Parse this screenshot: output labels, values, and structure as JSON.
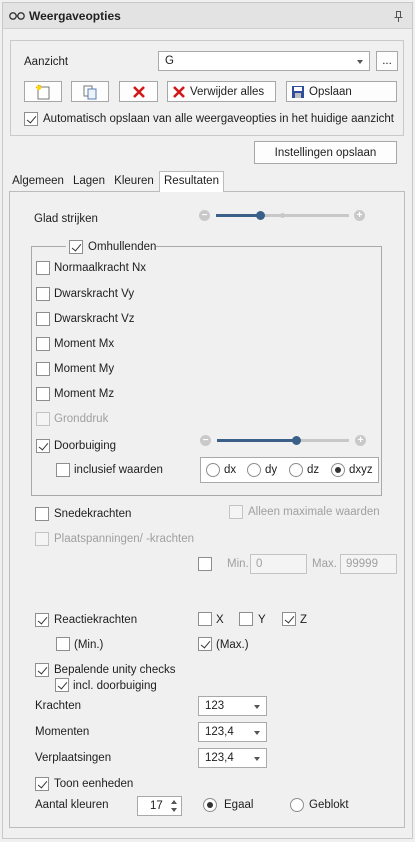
{
  "title": "Weergaveopties",
  "view": {
    "label": "Aanzicht",
    "value": "G",
    "more_label": "...",
    "delete_all_label": "Verwijder alles",
    "save_label": "Opslaan",
    "autosave_label": "Automatisch opslaan van alle weergaveopties in het huidige aanzicht",
    "save_settings_label": "Instellingen opslaan"
  },
  "tabs": [
    {
      "label": "Algemeen"
    },
    {
      "label": "Lagen"
    },
    {
      "label": "Kleuren"
    },
    {
      "label": "Resultaten"
    }
  ],
  "results": {
    "smooth_label": "Glad strijken",
    "smooth_level": 0.33,
    "envelopes_label": "Omhullenden",
    "options": [
      {
        "label": "Normaalkracht Nx",
        "checked": false,
        "disabled": false
      },
      {
        "label": "Dwarskracht Vy",
        "checked": false,
        "disabled": false
      },
      {
        "label": "Dwarskracht Vz",
        "checked": false,
        "disabled": false
      },
      {
        "label": "Moment Mx",
        "checked": false,
        "disabled": false
      },
      {
        "label": "Moment My",
        "checked": false,
        "disabled": false
      },
      {
        "label": "Moment Mz",
        "checked": false,
        "disabled": false
      },
      {
        "label": "Gronddruk",
        "checked": false,
        "disabled": true
      },
      {
        "label": "Doorbuiging",
        "checked": true,
        "disabled": false
      }
    ],
    "deflection_level": 0.6,
    "incl_values_label": "inclusief waarden",
    "dirs": [
      {
        "label": "dx",
        "selected": false
      },
      {
        "label": "dy",
        "selected": false
      },
      {
        "label": "dz",
        "selected": false
      },
      {
        "label": "dxyz",
        "selected": true
      }
    ],
    "section_forces_label": "Snedekrachten",
    "only_max_label": "Alleen maximale waarden",
    "plate_stress_label": "Plaatspanningen/ -krachten",
    "min_label": "Min.",
    "min_value": "0",
    "max_label": "Max.",
    "max_value": "99999",
    "reactions_label": "Reactiekrachten",
    "x_label": "X",
    "y_label": "Y",
    "z_label": "Z",
    "min_paren_label": "(Min.)",
    "max_paren_label": "(Max.)",
    "unity_label": "Bepalende unity checks",
    "incl_deflection_label": "incl. doorbuiging",
    "forces_label": "Krachten",
    "forces_value": "123",
    "moments_label": "Momenten",
    "moments_value": "123,4",
    "displacements_label": "Verplaatsingen",
    "displacements_value": "123,4",
    "show_units_label": "Toon eenheden",
    "num_colors_label": "Aantal kleuren",
    "num_colors_value": "17",
    "uniform_label": "Egaal",
    "blocked_label": "Geblokt"
  }
}
